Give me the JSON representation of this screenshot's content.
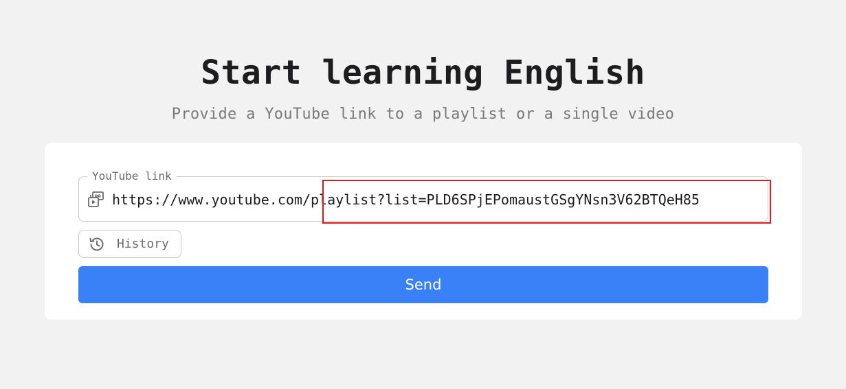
{
  "header": {
    "title": "Start learning English",
    "subtitle": "Provide a YouTube link to a playlist or a single video"
  },
  "form": {
    "link_field": {
      "legend": "YouTube link",
      "value": "https://www.youtube.com/playlist?list=PLD6SPjEPomaustGSgYNsn3V62BTQeH85",
      "icon": "video-playlist-icon"
    },
    "history_button": {
      "label": "History",
      "icon": "history-icon"
    },
    "send_button": {
      "label": "Send"
    }
  },
  "colors": {
    "background": "#f2f2f2",
    "card": "#ffffff",
    "accent": "#3a80f7",
    "highlight": "#e0181b"
  }
}
